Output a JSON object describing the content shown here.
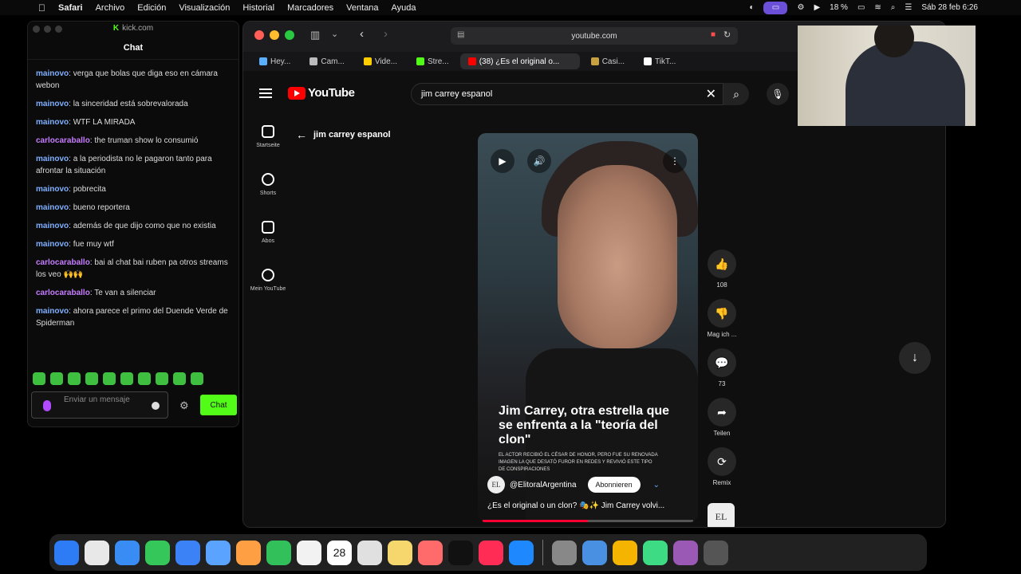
{
  "menubar": {
    "apple": "",
    "items": [
      "Safari",
      "Archivo",
      "Edición",
      "Visualización",
      "Historial",
      "Marcadores",
      "Ventana",
      "Ayuda"
    ],
    "battery": "18 %",
    "datetime": "Sáb 28 feb 6:26"
  },
  "kick": {
    "url": "kick.com",
    "title": "Chat",
    "messages": [
      {
        "user": "mainovo",
        "text": "verga que bolas que diga eso en cámara webon",
        "color": "#7fb0ff"
      },
      {
        "user": "mainovo",
        "text": "la sinceridad está sobrevalorada",
        "color": "#7fb0ff"
      },
      {
        "user": "mainovo",
        "text": "WTF LA MIRADA",
        "color": "#7fb0ff"
      },
      {
        "user": "carlocaraballo",
        "text": "the truman show lo consumió",
        "color": "#c77dff"
      },
      {
        "user": "mainovo",
        "text": "a la periodista no le pagaron tanto para afrontar la situación",
        "color": "#7fb0ff"
      },
      {
        "user": "mainovo",
        "text": "pobrecita",
        "color": "#7fb0ff"
      },
      {
        "user": "mainovo",
        "text": "bueno reportera",
        "color": "#7fb0ff"
      },
      {
        "user": "mainovo",
        "text": "además de que dijo como que no existia",
        "color": "#7fb0ff"
      },
      {
        "user": "mainovo",
        "text": "fue muy wtf",
        "color": "#7fb0ff"
      },
      {
        "user": "carlocaraballo",
        "text": "bai al chat bai ruben pa otros streams los veo 🙌🙌",
        "color": "#c77dff"
      },
      {
        "user": "carlocaraballo",
        "text": "Te van a silenciar",
        "color": "#c77dff"
      },
      {
        "user": "mainovo",
        "text": "ahora parece el primo del Duende Verde de Spiderman",
        "color": "#7fb0ff"
      }
    ],
    "input_placeholder": "Enviar un mensaje",
    "send_label": "Chat",
    "accent": "#53fc18"
  },
  "safari": {
    "address": "youtube.com",
    "tabs": [
      {
        "label": "Hey...",
        "color": "#5ab0ff"
      },
      {
        "label": "Cam...",
        "color": "#bbbbbb"
      },
      {
        "label": "Vide...",
        "color": "#ffcc00"
      },
      {
        "label": "Stre...",
        "color": "#53fc18"
      },
      {
        "label": "(38) ¿Es el original o...",
        "color": "#ff0000"
      },
      {
        "label": "Casi...",
        "color": "#c8a040"
      },
      {
        "label": "TikT...",
        "color": "#ffffff"
      }
    ]
  },
  "youtube": {
    "logo": "YouTube",
    "search_value": "jim carrey espanol",
    "back_title": "jim carrey espanol",
    "sidebar": [
      "Startseite",
      "Shorts",
      "Abos",
      "Mein YouTube"
    ],
    "video": {
      "headline": "Jim Carrey, otra estrella que se enfrenta a la \"teoría del clon\"",
      "subtext": "EL ACTOR RECIBIÓ EL CÉSAR DE HONOR, PERO FUE SU RENOVADA IMAGEN LA QUE DESATÓ FUROR EN REDES Y REVIVIÓ ESTE TIPO DE CONSPIRACIONES",
      "channel": "@ElitoralArgentina",
      "channel_initials": "EL",
      "subscribe": "Abonnieren",
      "title": "¿Es el original o un clon? 🎭✨ Jim Carrey volvi...",
      "progress": 0.5
    },
    "actions": [
      {
        "icon": "thumbs-up-icon",
        "glyph": "👍",
        "label": "108"
      },
      {
        "icon": "thumbs-down-icon",
        "glyph": "👎",
        "label": "Mag ich ..."
      },
      {
        "icon": "comment-icon",
        "glyph": "💬",
        "label": "73"
      },
      {
        "icon": "share-icon",
        "glyph": "➦",
        "label": "Teilen"
      },
      {
        "icon": "remix-icon",
        "glyph": "⟳",
        "label": "Remix"
      }
    ]
  },
  "dock": {
    "apps": [
      "#2d7cf6",
      "#e8e8e8",
      "#3a8cf5",
      "#35c759",
      "#3b82f6",
      "#5aa3ff",
      "#ff9f43",
      "#32c05a",
      "#f2f2f2",
      "#b0b0b0",
      "#e0e0e0",
      "#f5d76e",
      "#ff6b6b",
      "#111111",
      "#ff2d55",
      "#1e88ff",
      "#888888",
      "#4a90e2",
      "#f4b400",
      "#3ddc84",
      "#9b59b6",
      "#555555"
    ],
    "calendar_day": "28"
  }
}
